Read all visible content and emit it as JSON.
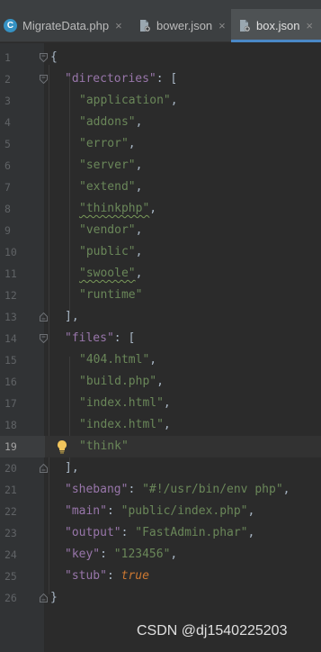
{
  "tabs": [
    {
      "label": "MigrateData.php",
      "close": "×",
      "icon": "php-class-icon"
    },
    {
      "label": "bower.json",
      "close": "×",
      "icon": "json-file-icon"
    },
    {
      "label": "box.json",
      "close": "×",
      "icon": "json-file-icon",
      "active": true
    }
  ],
  "colors": {
    "active_tab_underline": "#4a88c7",
    "key": "#9876aa",
    "string": "#6a8759",
    "keyword": "#cc7832",
    "background": "#2b2b2b"
  },
  "current_line": 19,
  "editor": {
    "line_numbers": [
      "1",
      "2",
      "3",
      "4",
      "5",
      "6",
      "7",
      "8",
      "9",
      "10",
      "11",
      "12",
      "13",
      "14",
      "15",
      "16",
      "17",
      "18",
      "19",
      "20",
      "21",
      "22",
      "23",
      "24",
      "25",
      "26"
    ],
    "l1": {
      "brace": "{"
    },
    "l2": {
      "key": "\"directories\"",
      "punct": ": ["
    },
    "l3": {
      "val": "\"application\"",
      "punct": ","
    },
    "l4": {
      "val": "\"addons\"",
      "punct": ","
    },
    "l5": {
      "val": "\"error\"",
      "punct": ","
    },
    "l6": {
      "val": "\"server\"",
      "punct": ","
    },
    "l7": {
      "val": "\"extend\"",
      "punct": ","
    },
    "l8": {
      "val": "\"thinkphp\"",
      "punct": ","
    },
    "l9": {
      "val": "\"vendor\"",
      "punct": ","
    },
    "l10": {
      "val": "\"public\"",
      "punct": ","
    },
    "l11": {
      "val": "\"swoole\"",
      "punct": ","
    },
    "l12": {
      "val": "\"runtime\""
    },
    "l13": {
      "punct": "],"
    },
    "l14": {
      "key": "\"files\"",
      "punct": ": ["
    },
    "l15": {
      "val": "\"404.html\"",
      "punct": ","
    },
    "l16": {
      "val": "\"build.php\"",
      "punct": ","
    },
    "l17": {
      "val": "\"index.html\"",
      "punct": ","
    },
    "l18": {
      "val": "\"index.html\"",
      "punct": ","
    },
    "l19": {
      "val": "\"think\""
    },
    "l20": {
      "punct": "],"
    },
    "l21": {
      "key": "\"shebang\"",
      "colon": ": ",
      "val": "\"#!/usr/bin/env php\"",
      "punct": ","
    },
    "l22": {
      "key": "\"main\"",
      "colon": ": ",
      "val": "\"public/index.php\"",
      "punct": ","
    },
    "l23": {
      "key": "\"output\"",
      "colon": ": ",
      "val": "\"FastAdmin.phar\"",
      "punct": ","
    },
    "l24": {
      "key": "\"key\"",
      "colon": ": ",
      "val": "\"123456\"",
      "punct": ","
    },
    "l25": {
      "key": "\"stub\"",
      "colon": ": ",
      "val": "true"
    },
    "l26": {
      "brace": "}"
    }
  },
  "watermark": "CSDN @dj1540225203"
}
